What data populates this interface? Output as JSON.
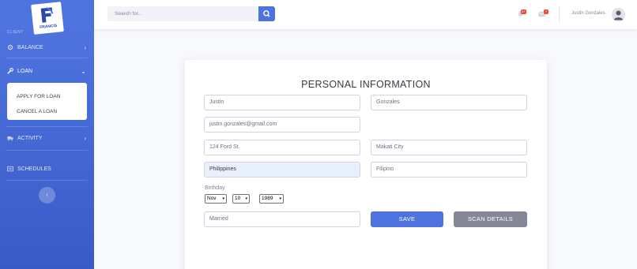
{
  "sidebar": {
    "logo_text": "FRANCIS",
    "heading": "CLIENT",
    "items": [
      {
        "label": "BALANCE",
        "icon": "gear-icon"
      },
      {
        "label": "LOAN",
        "icon": "wrench-icon"
      },
      {
        "label": "ACTIVITY",
        "icon": "truck-icon"
      },
      {
        "label": "SCHEDULES",
        "icon": "list-icon"
      }
    ],
    "loan_submenu": [
      "APPLY FOR LOAN",
      "CANCEL A LOAN"
    ],
    "toggle": "‹"
  },
  "topbar": {
    "search_placeholder": "Search for...",
    "alerts_count": "3+",
    "messages_count": "7",
    "user_name": "Justin Gonzales"
  },
  "form": {
    "title": "PERSONAL INFORMATION",
    "first_name": "Justin",
    "last_name": "Gonzales",
    "email": "justin.gonzales@gmail.com",
    "address": "124 Ford St.",
    "city": "Makati City",
    "country": "Philippines",
    "nationality": "Filipino",
    "birthday_label": "Birthday",
    "birth_month": "Nov",
    "birth_day": "10",
    "birth_year": "1989",
    "civil_status": "Married",
    "save_label": "SAVE",
    "scan_label": "SCAN DETAILS"
  },
  "colors": {
    "primary": "#4e73df",
    "secondary": "#858796",
    "danger": "#e74a3b"
  }
}
